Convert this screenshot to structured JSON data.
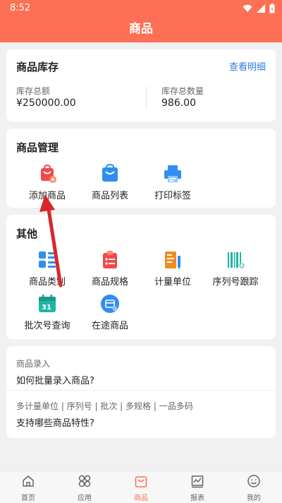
{
  "status_bar": {
    "time": "8:52"
  },
  "header": {
    "title": "商品"
  },
  "stock": {
    "title": "商品库存",
    "detail_link": "查看明细",
    "total_amount_label": "库存总额",
    "total_amount_value": "¥250000.00",
    "total_qty_label": "库存总数量",
    "total_qty_value": "986.00"
  },
  "management": {
    "title": "商品管理",
    "items": [
      {
        "label": "添加商品",
        "icon": "add-product-icon"
      },
      {
        "label": "商品列表",
        "icon": "product-list-icon"
      },
      {
        "label": "打印标签",
        "icon": "printer-icon"
      }
    ]
  },
  "others": {
    "title": "其他",
    "items": [
      {
        "label": "商品类别",
        "icon": "category-icon"
      },
      {
        "label": "商品规格",
        "icon": "spec-icon"
      },
      {
        "label": "计量单位",
        "icon": "unit-icon"
      },
      {
        "label": "序列号跟踪",
        "icon": "barcode-icon"
      },
      {
        "label": "批次号查询",
        "icon": "calendar-icon"
      },
      {
        "label": "在途商品",
        "icon": "in-transit-icon"
      }
    ]
  },
  "faq": {
    "q1_small": "商品录入",
    "q1_big": "如何批量录入商品?",
    "q2_small": "多计量单位 | 序列号 | 批次 | 多规格 | 一品多码",
    "q2_big": "支持哪些商品特性?"
  },
  "tabbar": {
    "tabs": [
      {
        "label": "首页",
        "icon": "home-icon"
      },
      {
        "label": "应用",
        "icon": "apps-icon"
      },
      {
        "label": "商品",
        "icon": "product-tab-icon"
      },
      {
        "label": "报表",
        "icon": "report-icon"
      },
      {
        "label": "我的",
        "icon": "profile-icon"
      }
    ],
    "active": "商品"
  },
  "colors": {
    "accent": "#fd7055",
    "link": "#2f7de1",
    "annotation_arrow": "#d9262a"
  }
}
